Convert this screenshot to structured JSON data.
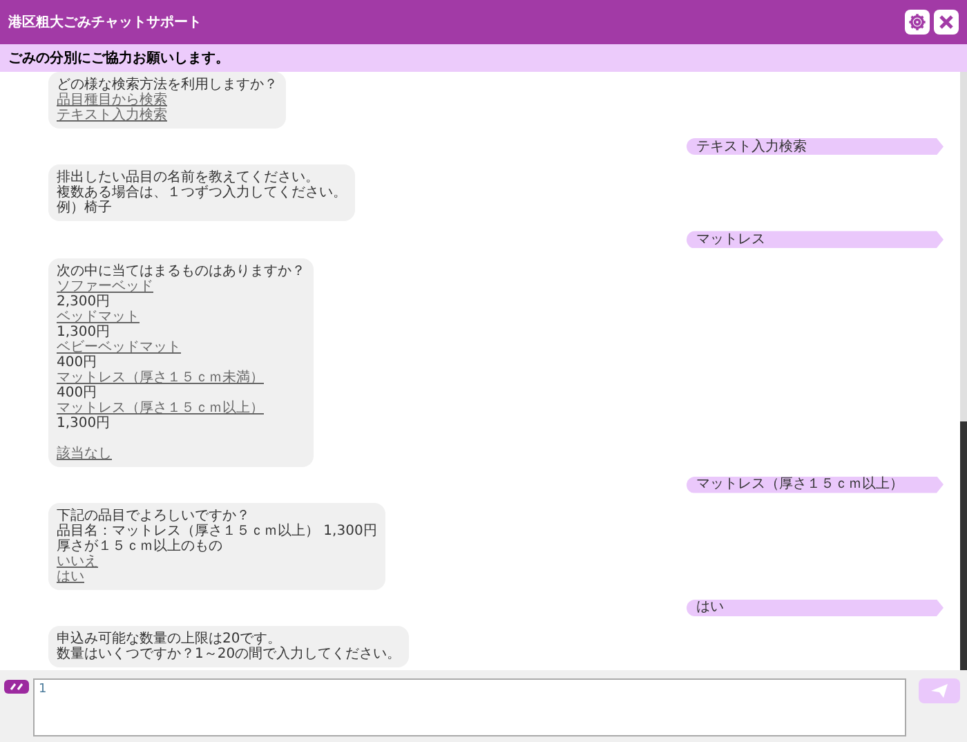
{
  "header": {
    "title": "港区粗大ごみチャットサポート"
  },
  "notice": "ごみの分別にご協力お願いします。",
  "messages": [
    {
      "kind": "bot",
      "lines": [
        {
          "kind": "text",
          "text": "どの様な検索方法を利用しますか？"
        },
        {
          "kind": "link",
          "text": "品目種目から検索"
        },
        {
          "kind": "link",
          "text": "テキスト入力検索"
        }
      ]
    },
    {
      "kind": "user",
      "text": "テキスト入力検索"
    },
    {
      "kind": "bot",
      "lines": [
        {
          "kind": "text",
          "text": "排出したい品目の名前を教えてください。"
        },
        {
          "kind": "text",
          "text": "複数ある場合は、１つずつ入力してください。"
        },
        {
          "kind": "text",
          "text": "例）椅子"
        }
      ]
    },
    {
      "kind": "user",
      "text": "マットレス"
    },
    {
      "kind": "bot",
      "lines": [
        {
          "kind": "text",
          "text": "次の中に当てはまるものはありますか？"
        },
        {
          "kind": "link",
          "text": "ソファーベッド"
        },
        {
          "kind": "text",
          "text": "2,300円"
        },
        {
          "kind": "link",
          "text": "ベッドマット"
        },
        {
          "kind": "text",
          "text": "1,300円"
        },
        {
          "kind": "link",
          "text": "ベビーベッドマット"
        },
        {
          "kind": "text",
          "text": "400円"
        },
        {
          "kind": "link",
          "text": "マットレス（厚さ１５ｃｍ未満）"
        },
        {
          "kind": "text",
          "text": "400円"
        },
        {
          "kind": "link",
          "text": "マットレス（厚さ１５ｃｍ以上）"
        },
        {
          "kind": "text",
          "text": "1,300円"
        },
        {
          "kind": "blank"
        },
        {
          "kind": "link",
          "text": "該当なし"
        }
      ]
    },
    {
      "kind": "user",
      "text": "マットレス（厚さ１５ｃｍ以上）"
    },
    {
      "kind": "bot",
      "lines": [
        {
          "kind": "text",
          "text": "下記の品目でよろしいですか？"
        },
        {
          "kind": "text",
          "text": "品目名：マットレス（厚さ１５ｃｍ以上） 1,300円"
        },
        {
          "kind": "text",
          "text": "厚さが１５ｃｍ以上のもの"
        },
        {
          "kind": "link",
          "text": "いいえ"
        },
        {
          "kind": "link",
          "text": "はい"
        }
      ]
    },
    {
      "kind": "user",
      "text": "はい"
    },
    {
      "kind": "bot",
      "lines": [
        {
          "kind": "text",
          "text": "申込み可能な数量の上限は20です。"
        },
        {
          "kind": "text",
          "text": "数量はいくつですか？1～20の間で入力してください。"
        }
      ]
    }
  ],
  "input": {
    "value": "1"
  }
}
